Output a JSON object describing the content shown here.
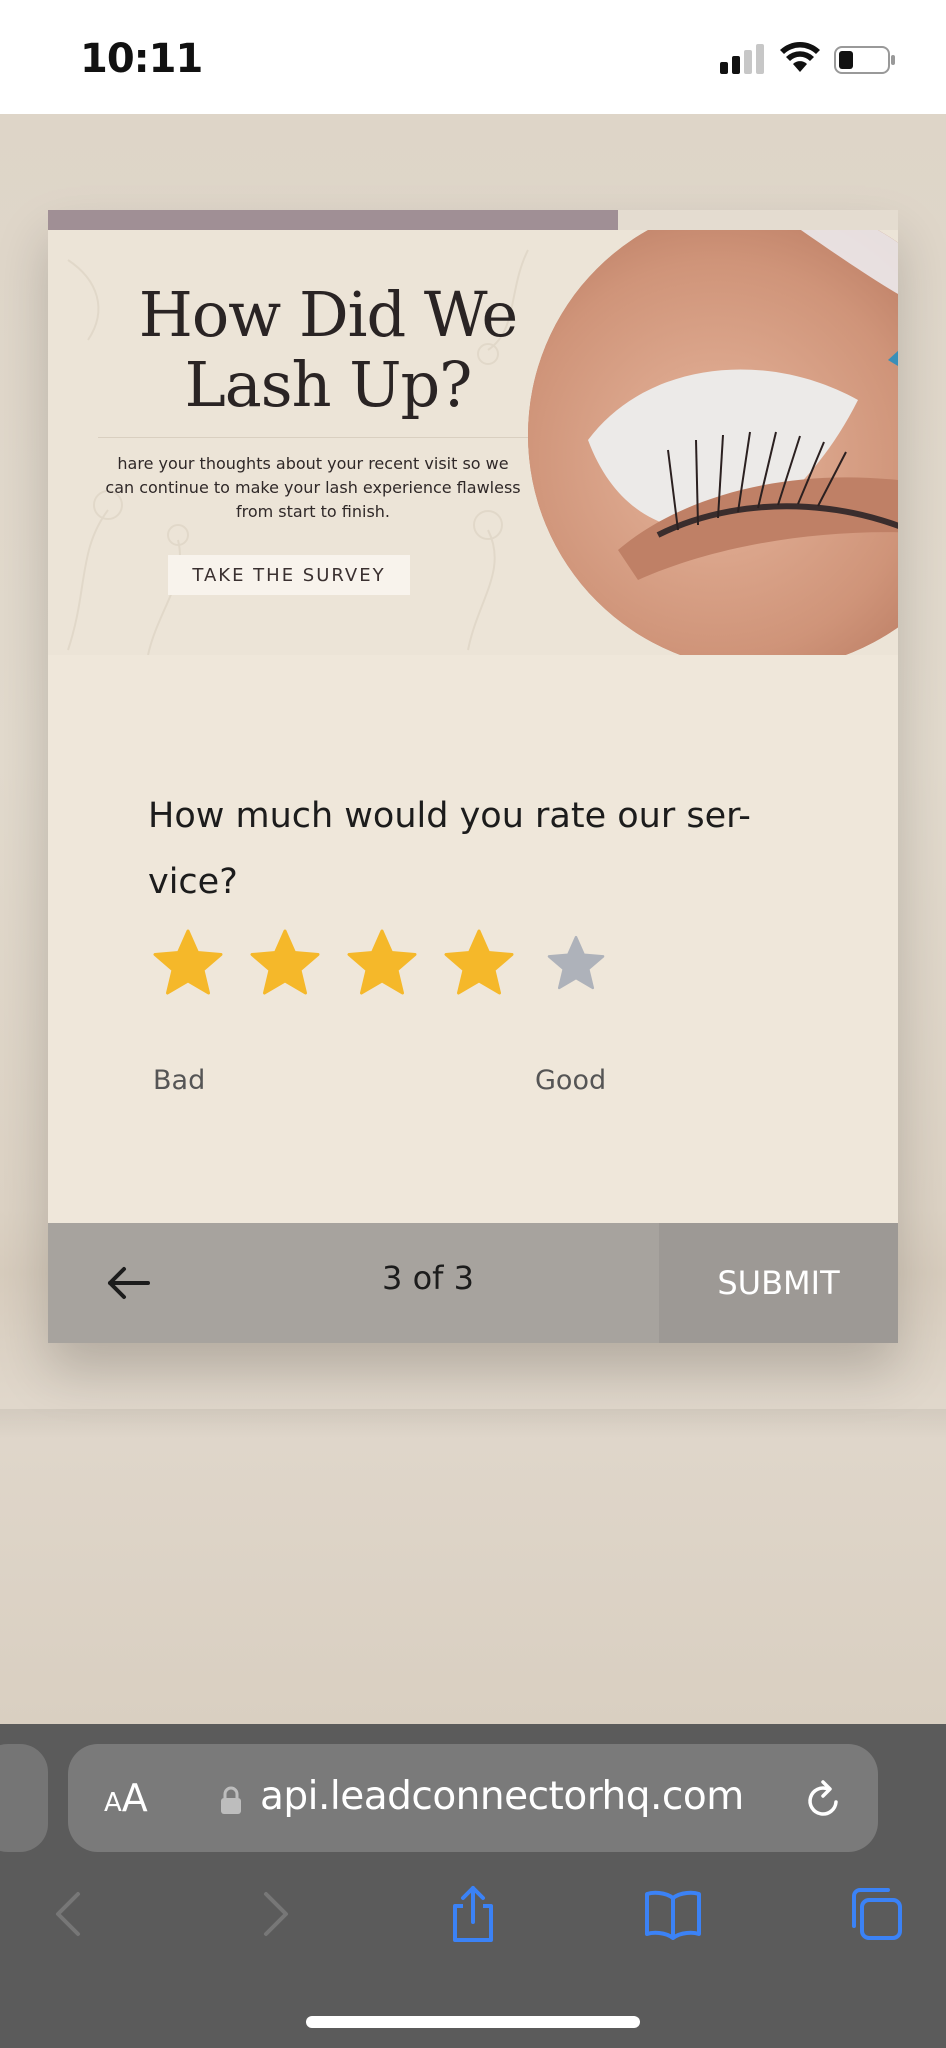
{
  "status_bar": {
    "time": "10:11"
  },
  "survey": {
    "progress_fraction": 0.67,
    "banner": {
      "headline_line1": "How Did We",
      "headline_line2": "Lash Up?",
      "body": "hare your thoughts about your recent visit so we can continue to make your lash experience flawless from start to finish.",
      "cta_label": "TAKE THE SURVEY"
    },
    "question": "How much would you rate our ser-vice?",
    "rating": {
      "max": 5,
      "value": 4,
      "filled_color": "#f5b82a",
      "empty_color": "#aeb2ba",
      "low_label": "Bad",
      "high_label": "Good"
    },
    "footer": {
      "back_icon": "arrow-left-icon",
      "page_indicator": "3 of 3",
      "submit_label": "SUBMIT"
    }
  },
  "browser": {
    "aa_small": "A",
    "aa_big": "A",
    "url": "api.leadconnectorhq.com",
    "toolbar": [
      "back-icon",
      "forward-icon",
      "share-icon",
      "bookmarks-icon",
      "tabs-icon"
    ],
    "accent_color": "#3b82f6"
  }
}
